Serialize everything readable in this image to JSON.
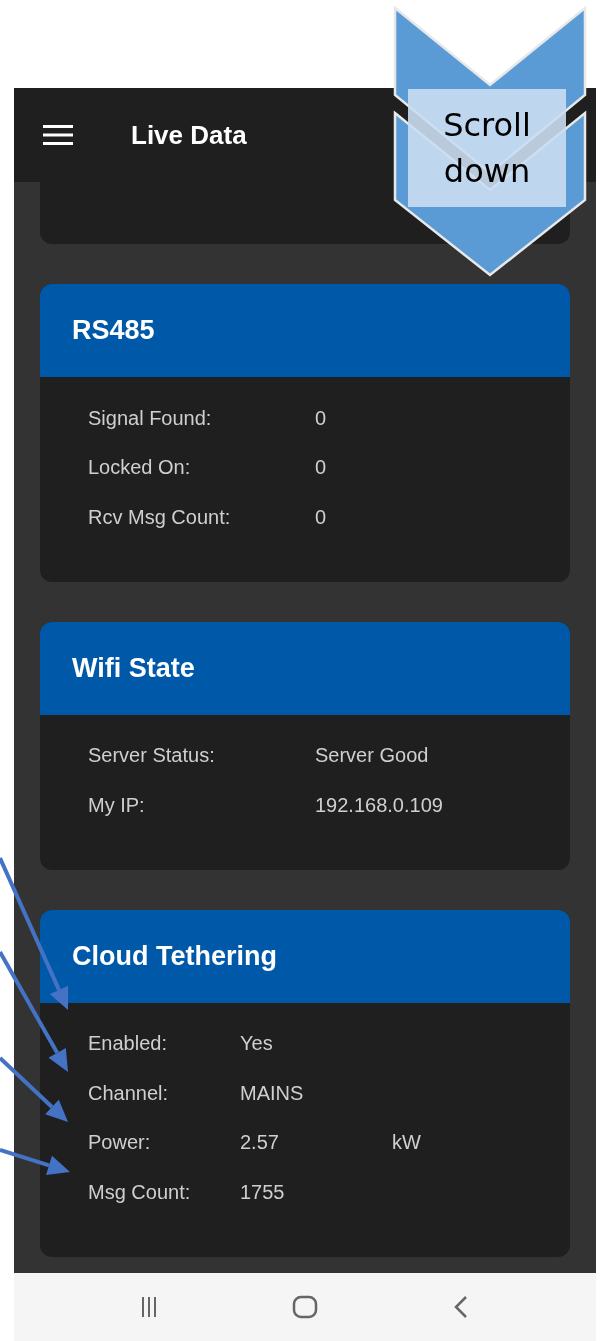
{
  "app_bar": {
    "title": "Live Data"
  },
  "cards": [
    {
      "title": "RS485",
      "rows": [
        {
          "label": "Signal Found:",
          "value": "0"
        },
        {
          "label": "Locked On:",
          "value": "0"
        },
        {
          "label": "Rcv Msg Count:",
          "value": "0"
        }
      ]
    },
    {
      "title": "Wifi State",
      "rows": [
        {
          "label": "Server Status:",
          "value": "Server Good"
        },
        {
          "label": "My IP:",
          "value": "192.168.0.109"
        }
      ]
    },
    {
      "title": "Cloud Tethering",
      "compact": true,
      "rows": [
        {
          "label": "Enabled:",
          "value": "Yes"
        },
        {
          "label": "Channel:",
          "value": "MAINS"
        },
        {
          "label": "Power:",
          "value": "2.57",
          "unit": "kW"
        },
        {
          "label": "Msg Count:",
          "value": "1755"
        }
      ]
    }
  ],
  "callout": {
    "text": "Scroll down"
  }
}
